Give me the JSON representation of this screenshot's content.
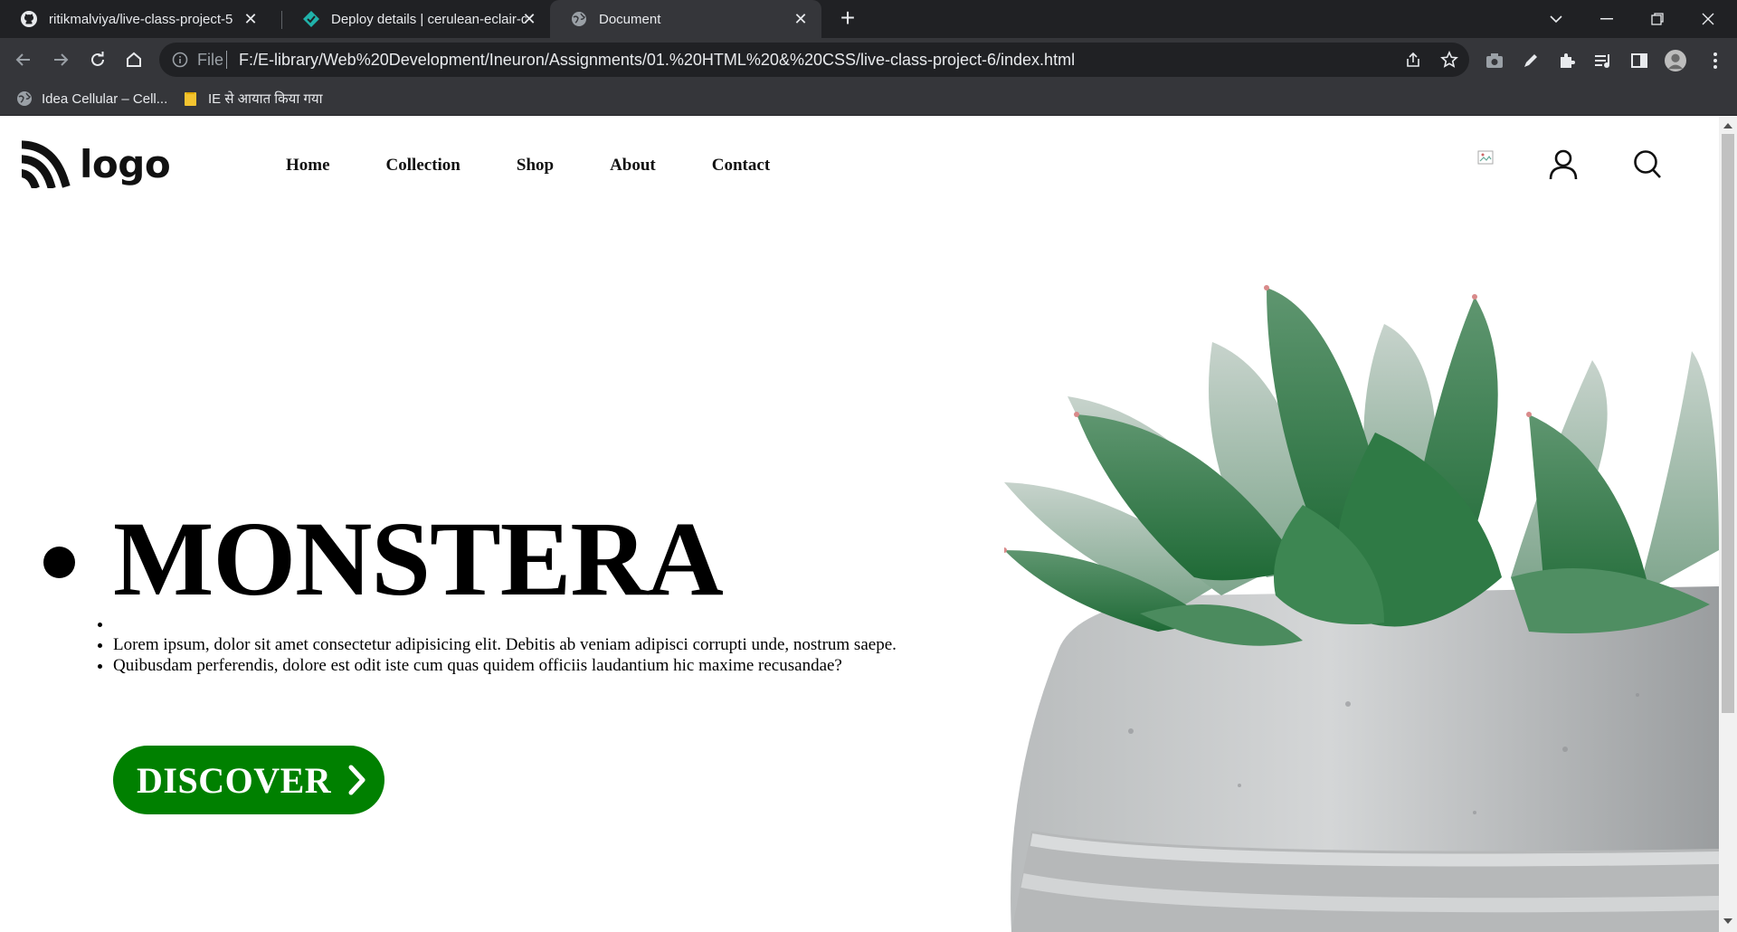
{
  "browser": {
    "tabs": [
      {
        "title": "ritikmalviya/live-class-project-5",
        "icon": "github-icon"
      },
      {
        "title": "Deploy details | cerulean-eclair-d",
        "icon": "netlify-icon"
      },
      {
        "title": "Document",
        "icon": "globe-icon"
      }
    ],
    "address": {
      "scheme_label": "File",
      "url": "F:/E-library/Web%20Development/Ineuron/Assignments/01.%20HTML%20&%20CSS/live-class-project-6/index.html"
    },
    "bookmarks": [
      {
        "label": "Idea Cellular – Cell...",
        "icon": "globe-icon"
      },
      {
        "label": "IE से आयात किया गया",
        "icon": "folder-icon"
      }
    ],
    "colors": {
      "frame": "#202124",
      "toolbar": "#35363a",
      "text": "#e8eaed"
    }
  },
  "page": {
    "logo_text": "logo",
    "nav": [
      "Home",
      "Collection",
      "Shop",
      "About",
      "Contact"
    ],
    "header_icons": [
      "broken-image-icon",
      "user-icon",
      "search-icon"
    ],
    "hero": {
      "title": "MONSTERA",
      "lines": [
        "",
        "Lorem ipsum, dolor sit amet consectetur adipisicing elit. Debitis ab veniam adipisci corrupti unde, nostrum saepe.",
        "Quibusdam perferendis, dolore est odit iste cum quas quidem officiis laudantium hic maxime recusandae?"
      ],
      "button_label": "DISCOVER",
      "button_color": "#008000"
    }
  }
}
